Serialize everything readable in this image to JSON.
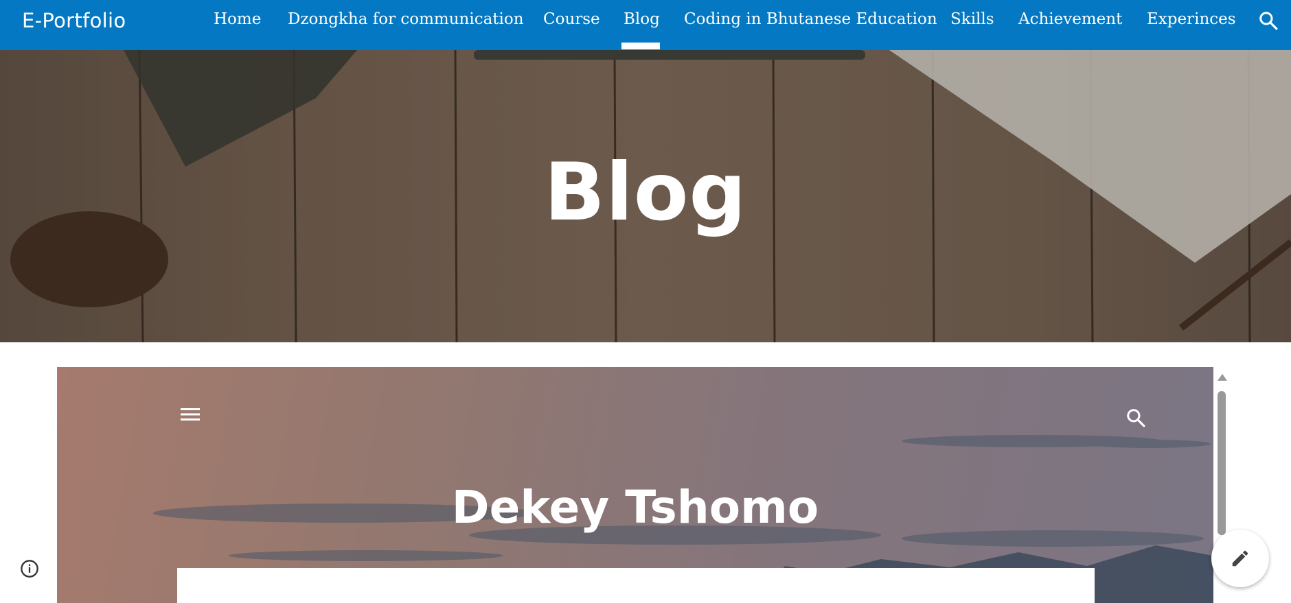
{
  "header": {
    "site_title": "E-Portfolio",
    "nav_items": [
      {
        "label": "Home"
      },
      {
        "label": "Dzongkha for communication"
      },
      {
        "label": "Course"
      },
      {
        "label": "Blog",
        "active": true
      },
      {
        "label": "Coding in Bhutanese Education"
      },
      {
        "label": "Skills"
      },
      {
        "label": "Achievement"
      },
      {
        "label": "Experinces"
      }
    ],
    "search_icon": "search-icon",
    "bg_color": "#0478c2"
  },
  "hero": {
    "title": "Blog"
  },
  "embed": {
    "title": "Dekey Tshomo",
    "menu_icon": "hamburger-menu-icon",
    "search_icon": "search-icon"
  },
  "footer": {
    "info_icon": "info-icon",
    "edit_icon": "pencil-icon"
  }
}
